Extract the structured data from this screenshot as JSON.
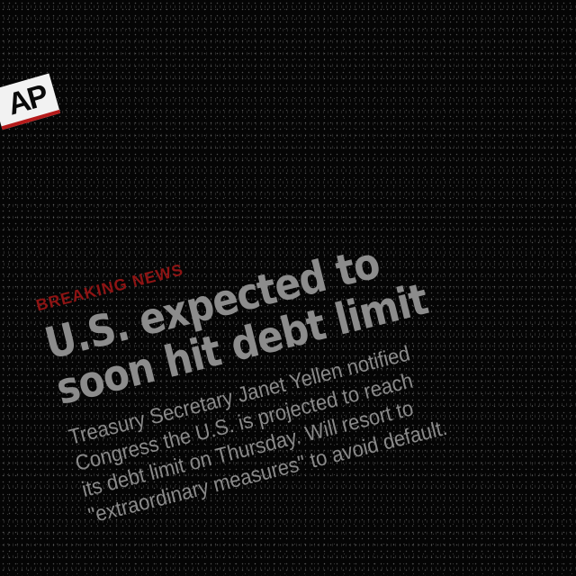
{
  "logo": {
    "text": "AP"
  },
  "story": {
    "kicker": "BREAKING NEWS",
    "headline_line1": "U.S. expected to",
    "headline_line2": "soon hit debt limit",
    "summary_line1": "Treasury Secretary Janet Yellen notified",
    "summary_line2": "Congress the U.S. is projected to reach",
    "summary_line3": "its debt limit on Thursday. Will resort to",
    "summary_line4": "\"extraordinary measures\" to avoid default."
  },
  "colors": {
    "background": "#050505",
    "logo_bg": "#f2f2f2",
    "logo_accent": "#b51b1b",
    "kicker": "#8e1414",
    "text": "#8c8c8c"
  }
}
